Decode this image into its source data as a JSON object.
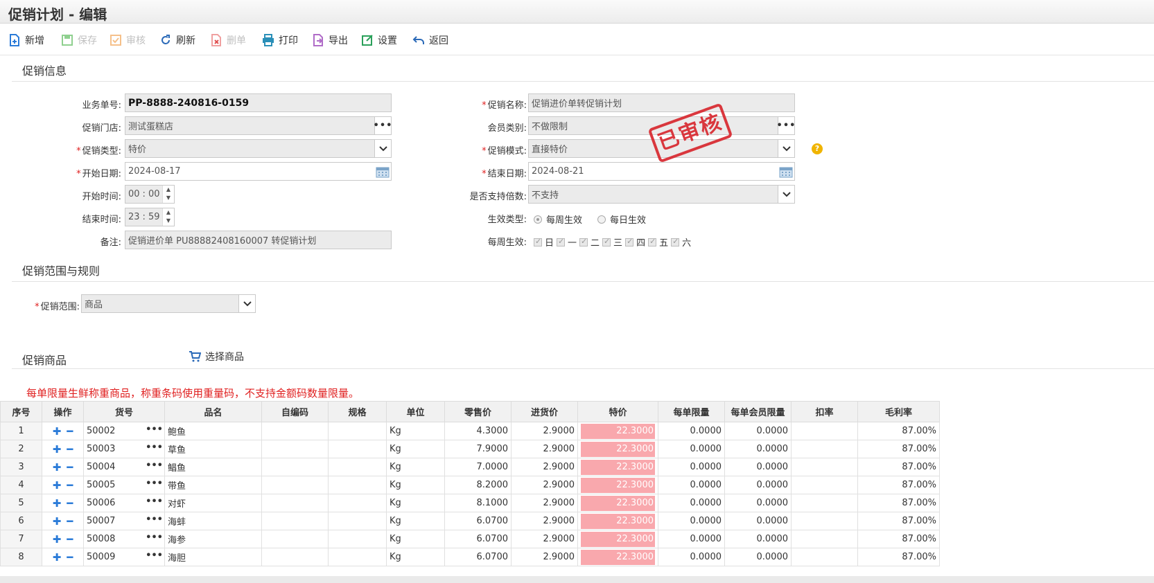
{
  "title": "促销计划 - 编辑",
  "toolbar": {
    "new": "新增",
    "save": "保存",
    "audit": "审核",
    "refresh": "刷新",
    "delete": "删单",
    "print": "打印",
    "export": "导出",
    "settings": "设置",
    "back": "返回"
  },
  "sections": {
    "info": "促销信息",
    "scope": "促销范围与规则",
    "goods": "促销商品"
  },
  "form": {
    "order_no_label": "业务单号:",
    "order_no": "PP-8888-240816-0159",
    "store_label": "促销门店:",
    "store": "测试蛋糕店",
    "type_label": "促销类型:",
    "type": "特价",
    "start_date_label": "开始日期:",
    "start_date": "2024-08-17",
    "start_time_label": "开始时间:",
    "start_hour": "00",
    "start_min": "00",
    "end_time_label": "结束时间:",
    "end_hour": "23",
    "end_min": "59",
    "remark_label": "备注:",
    "remark": "促销进价单 PU88882408160007 转促销计划",
    "name_label": "促销名称:",
    "name": "促销进价单转促销计划",
    "member_label": "会员类别:",
    "member": "不做限制",
    "mode_label": "促销模式:",
    "mode": "直接特价",
    "end_date_label": "结束日期:",
    "end_date": "2024-08-21",
    "multiple_label": "是否支持倍数:",
    "multiple": "不支持",
    "effect_type_label": "生效类型:",
    "effect_weekly": "每周生效",
    "effect_daily": "每日生效",
    "weekly_label": "每周生效:",
    "days": [
      "日",
      "一",
      "二",
      "三",
      "四",
      "五",
      "六"
    ],
    "scope_label": "促销范围:",
    "scope": "商品",
    "time_sep": ":"
  },
  "stamp": "已审核",
  "select_goods": "选择商品",
  "warning": "每单限量生鲜称重商品，称重条码使用重量码，不支持金额码数量限量。",
  "table": {
    "headers": [
      "序号",
      "操作",
      "货号",
      "品名",
      "自编码",
      "规格",
      "单位",
      "零售价",
      "进货价",
      "特价",
      "每单限量",
      "每单会员限量",
      "扣率",
      "毛利率"
    ],
    "rows": [
      {
        "seq": "1",
        "code": "50002",
        "name": "鲍鱼",
        "unit": "Kg",
        "retail": "4.3000",
        "cost": "2.9000",
        "special": "22.3000",
        "limit": "0.0000",
        "mlimit": "0.0000",
        "margin": "87.00%"
      },
      {
        "seq": "2",
        "code": "50003",
        "name": "草鱼",
        "unit": "Kg",
        "retail": "7.9000",
        "cost": "2.9000",
        "special": "22.3000",
        "limit": "0.0000",
        "mlimit": "0.0000",
        "margin": "87.00%"
      },
      {
        "seq": "3",
        "code": "50004",
        "name": "鲳鱼",
        "unit": "Kg",
        "retail": "7.0000",
        "cost": "2.9000",
        "special": "22.3000",
        "limit": "0.0000",
        "mlimit": "0.0000",
        "margin": "87.00%"
      },
      {
        "seq": "4",
        "code": "50005",
        "name": "带鱼",
        "unit": "Kg",
        "retail": "8.2000",
        "cost": "2.9000",
        "special": "22.3000",
        "limit": "0.0000",
        "mlimit": "0.0000",
        "margin": "87.00%"
      },
      {
        "seq": "5",
        "code": "50006",
        "name": "对虾",
        "unit": "Kg",
        "retail": "8.1000",
        "cost": "2.9000",
        "special": "22.3000",
        "limit": "0.0000",
        "mlimit": "0.0000",
        "margin": "87.00%"
      },
      {
        "seq": "6",
        "code": "50007",
        "name": "海蚌",
        "unit": "Kg",
        "retail": "6.0700",
        "cost": "2.9000",
        "special": "22.3000",
        "limit": "0.0000",
        "mlimit": "0.0000",
        "margin": "87.00%"
      },
      {
        "seq": "7",
        "code": "50008",
        "name": "海参",
        "unit": "Kg",
        "retail": "6.0700",
        "cost": "2.9000",
        "special": "22.3000",
        "limit": "0.0000",
        "mlimit": "0.0000",
        "margin": "87.00%"
      },
      {
        "seq": "8",
        "code": "50009",
        "name": "海胆",
        "unit": "Kg",
        "retail": "6.0700",
        "cost": "2.9000",
        "special": "22.3000",
        "limit": "0.0000",
        "mlimit": "0.0000",
        "margin": "87.00%"
      }
    ]
  },
  "colors": {
    "special_bg": "#f9a8ad",
    "stamp": "#d8282f",
    "warning": "#e02020",
    "accent": "#2b7bd8"
  }
}
